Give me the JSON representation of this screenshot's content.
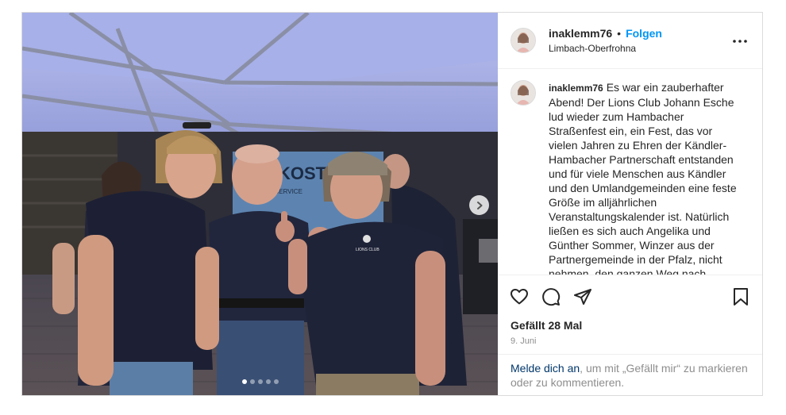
{
  "post": {
    "username": "inaklemm76",
    "separator": "•",
    "follow_label": "Folgen",
    "location": "Limbach-Oberfrohna",
    "caption_user": "inaklemm76",
    "caption_text": "Es war ein zauberhafter Abend! Der Lions Club Johann Esche lud wieder zum Hambacher Straßenfest ein, ein Fest, das vor vielen Jahren zu Ehren der Kändler-Hambacher Partnerschaft entstanden und für viele Menschen aus Kändler und den Umlandgemeinden eine feste Größe im alljährlichen Veranstaltungskalender ist. Natürlich ließen es sich auch Angelika und Günther Sommer, Winzer aus der Partnergemeinde in der Pfalz, nicht nehmen, den ganzen Weg nach",
    "likes": "Gefällt 28 Mal",
    "date": "9. Juni"
  },
  "media": {
    "slide_count": 5,
    "active_slide": 1,
    "sign_text": "ICKOST",
    "sign_subtext": "PARTYSERVICE",
    "shirt_text": "LIONS CLUB\nLimbach-Oberfrohna\n\"JOHANN ESCHE\""
  },
  "login": {
    "link": "Melde dich an",
    "rest": ", um mit „Gefällt mir“ zu markieren oder zu kommentieren."
  },
  "icons": {
    "more": "more-options-icon",
    "like": "heart-icon",
    "comment": "comment-icon",
    "share": "paper-plane-icon",
    "save": "bookmark-icon",
    "next": "chevron-right-icon"
  },
  "colors": {
    "accent": "#0095f6",
    "link": "#00376b",
    "muted": "#8e8e8e"
  }
}
